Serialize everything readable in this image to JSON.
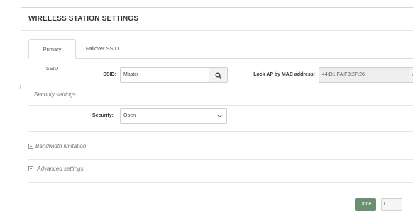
{
  "dialog": {
    "title": "WIRELESS STATION SETTINGS"
  },
  "tabs": [
    {
      "label": "Primary SSID",
      "active": true
    },
    {
      "label": "Failover SSID",
      "active": false
    }
  ],
  "ssid": {
    "label": "SSID:",
    "value": "Master"
  },
  "lock_ap": {
    "label": "Lock AP by MAC address:",
    "value": "44:D1:FA:FB:2F:26",
    "button_glyph": "("
  },
  "security_settings": {
    "section_title": "Security settings",
    "label": "Security:",
    "selected": "Open"
  },
  "sections": {
    "bandwidth": "Bandwidth limitation",
    "advanced": "Advanced settings"
  },
  "footer": {
    "done_label": "Done",
    "next_label": "C"
  },
  "colors": {
    "done_button": "#6b8f71"
  }
}
